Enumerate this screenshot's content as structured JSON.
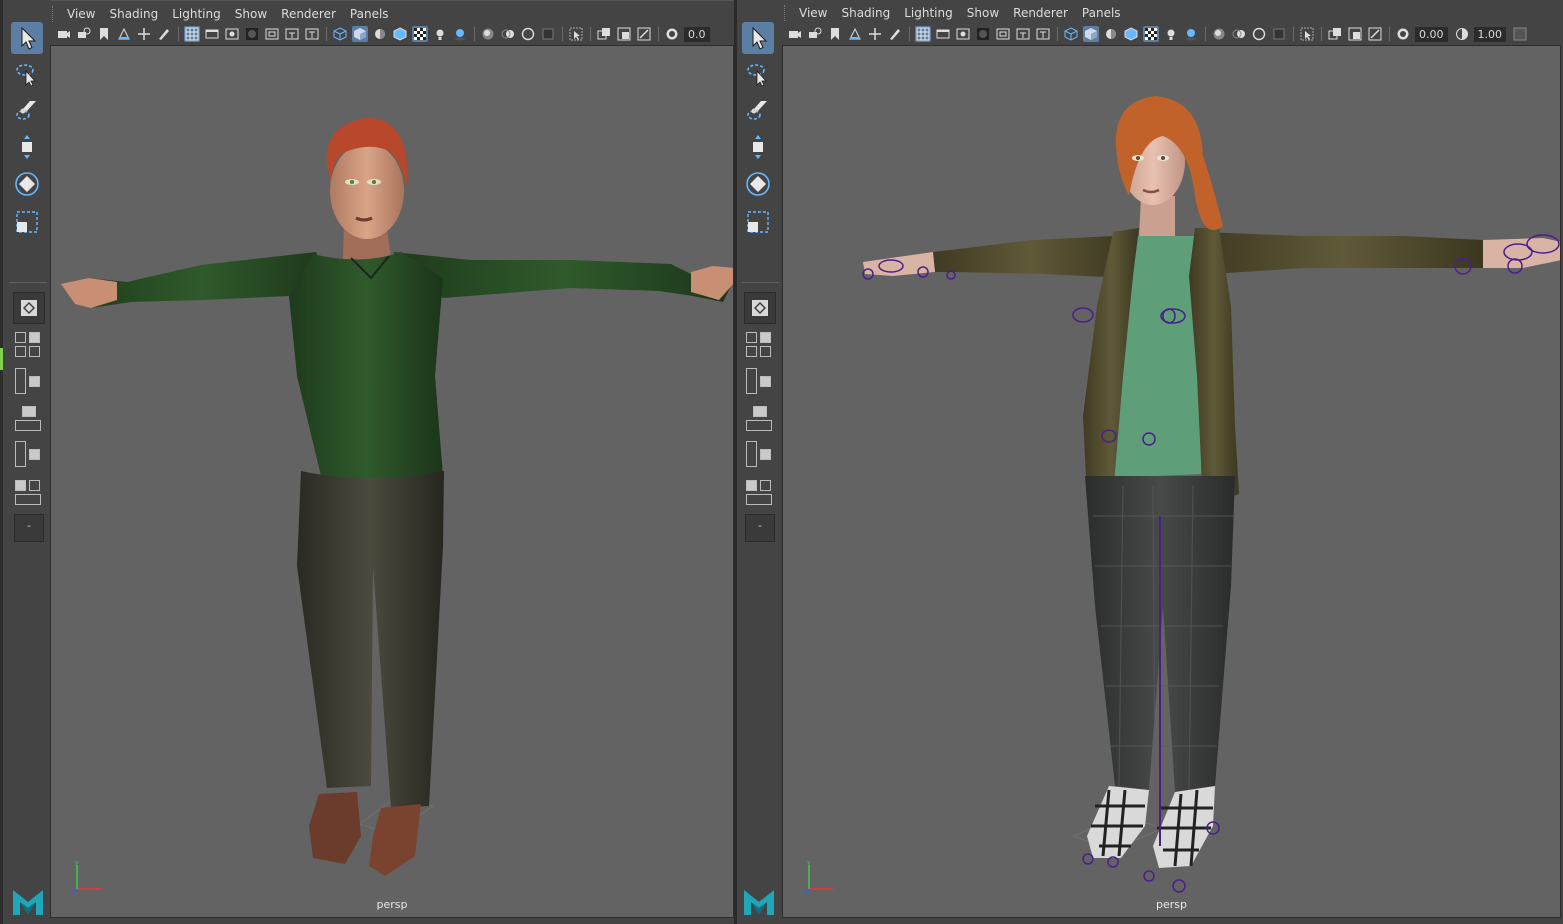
{
  "left_panel": {
    "menus": [
      "View",
      "Shading",
      "Lighting",
      "Show",
      "Renderer",
      "Panels"
    ],
    "fields": [
      "0.0"
    ],
    "camera_label": "persp"
  },
  "right_panel": {
    "menus": [
      "View",
      "Shading",
      "Lighting",
      "Show",
      "Renderer",
      "Panels"
    ],
    "fields": [
      "0.00",
      "1.00"
    ],
    "camera_label": "persp"
  },
  "toolbox": {
    "tools": [
      "select-tool-icon",
      "lasso-tool-icon",
      "paint-select-tool-icon",
      "move-tool-icon",
      "rotate-tool-icon",
      "scale-tool-icon"
    ],
    "active_tool": "select-tool-icon",
    "collapse_label": "-"
  },
  "colors": {
    "viewport_bg": "#636363",
    "ui_bg": "#444444",
    "highlight": "#5c7ea3",
    "rig_controls": "#4a1f8a",
    "axis_x": "#e33b3b",
    "axis_y": "#39d14a",
    "axis_z": "#3b5ae3"
  }
}
